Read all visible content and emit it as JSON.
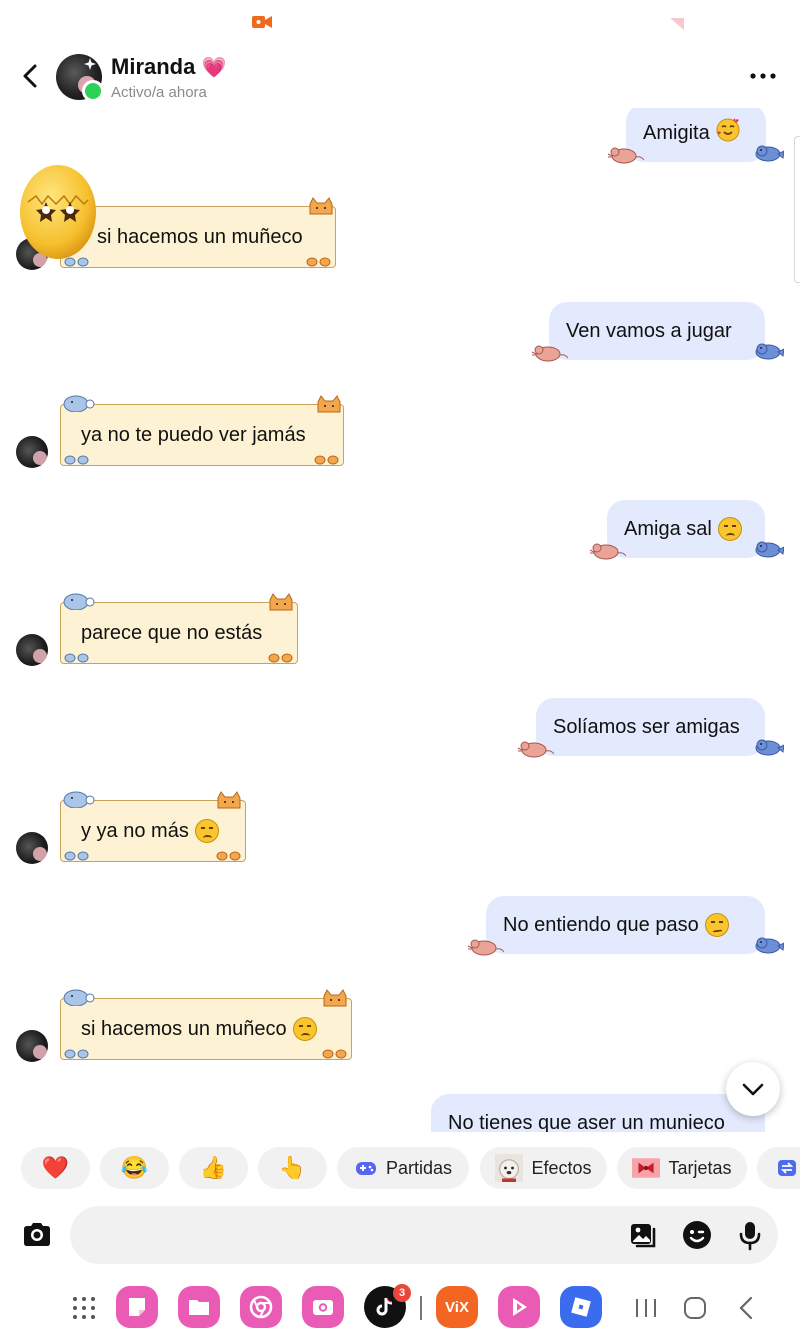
{
  "contact": {
    "name": "Miranda",
    "name_emoji": "💗",
    "status": "Activo/a ahora"
  },
  "messages": [
    {
      "dir": "out",
      "text": "Amigita",
      "emoji": "smiling-face-with-hearts"
    },
    {
      "dir": "in",
      "text": "si hacemos un muñeco",
      "emoji": null,
      "sticker_over_avatar": "egg-with-star-eyes"
    },
    {
      "dir": "out",
      "text": "Ven  vamos a jugar",
      "emoji": null
    },
    {
      "dir": "in",
      "text": "ya no te puedo ver jamás",
      "emoji": null
    },
    {
      "dir": "out",
      "text": "Amiga sal",
      "emoji": "disappointed-face"
    },
    {
      "dir": "in",
      "text": "parece que no estás",
      "emoji": null
    },
    {
      "dir": "out",
      "text": "Solíamos ser amigas",
      "emoji": null
    },
    {
      "dir": "in",
      "text": "y ya no más",
      "emoji": "disappointed-face"
    },
    {
      "dir": "out",
      "text": "No entiendo que paso",
      "emoji": "confused-face"
    },
    {
      "dir": "in",
      "text": "si hacemos un muñeco",
      "emoji": "disappointed-face"
    },
    {
      "dir": "out",
      "text": "No tienes que aser un munieco",
      "emoji": null
    }
  ],
  "quick_bar": {
    "reactions": [
      "❤️",
      "😂",
      "👍",
      "👆"
    ],
    "partidas": "Partidas",
    "efectos": "Efectos",
    "tarjetas": "Tarjetas"
  },
  "dock": {
    "tiktok_badge": "3"
  },
  "colors": {
    "outgoing_bubble": "#e4eafd",
    "incoming_bubble": "#fdf3d4",
    "online": "#2ed158"
  }
}
